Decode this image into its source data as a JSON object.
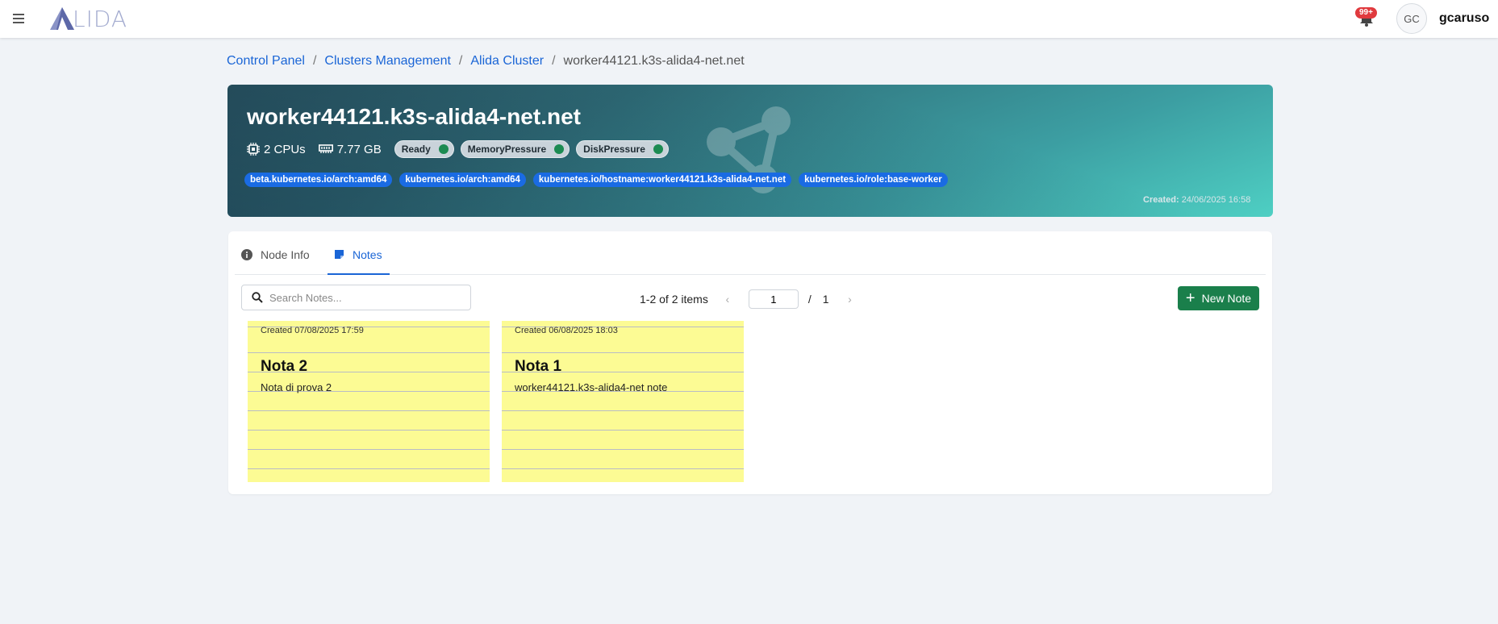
{
  "app": {
    "logo_text": "LIDA",
    "notification_count": "99+",
    "avatar_initials": "GC",
    "username": "gcaruso"
  },
  "breadcrumb": {
    "items": [
      "Control Panel",
      "Clusters Management",
      "Alida Cluster"
    ],
    "current": "worker44121.k3s-alida4-net.net"
  },
  "node": {
    "name": "worker44121.k3s-alida4-net.net",
    "cpus": "2 CPUs",
    "memory": "7.77 GB",
    "conditions": [
      {
        "label": "Ready",
        "status": "ok"
      },
      {
        "label": "MemoryPressure",
        "status": "ok"
      },
      {
        "label": "DiskPressure",
        "status": "ok"
      }
    ],
    "labels": [
      "beta.kubernetes.io/arch:amd64",
      "kubernetes.io/arch:amd64",
      "kubernetes.io/hostname:worker44121.k3s-alida4-net.net",
      "kubernetes.io/role:base-worker"
    ],
    "created_label": "Created:",
    "created_value": "24/06/2025 16:58"
  },
  "tabs": [
    {
      "label": "Node Info",
      "icon": "info-icon",
      "active": false
    },
    {
      "label": "Notes",
      "icon": "note-icon",
      "active": true
    }
  ],
  "notes_toolbar": {
    "search_placeholder": "Search Notes...",
    "summary": "1-2 of 2 items",
    "page": "1",
    "separator": "/",
    "total_pages": "1",
    "new_note_label": "New Note"
  },
  "notes": [
    {
      "created": "Created 07/08/2025 17:59",
      "title": "Nota 2",
      "body": "Nota di prova 2"
    },
    {
      "created": "Created 06/08/2025 18:03",
      "title": "Nota 1",
      "body": "worker44121.k3s-alida4-net note"
    }
  ],
  "colors": {
    "accent": "#1a65d6",
    "success": "#1a7f4b",
    "note_bg": "#fcfb94",
    "badge": "#e03a3e"
  }
}
